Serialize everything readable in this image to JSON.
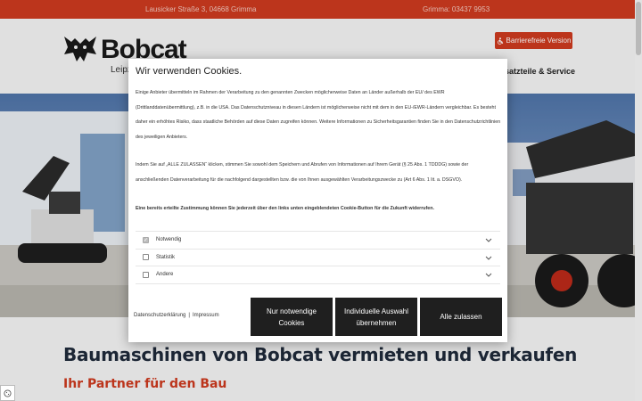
{
  "topbar": {
    "address": "Lausicker Straße 3, 04668 Grimma",
    "phone": "Grimma: 03437 9953"
  },
  "header": {
    "logo_text": "Bobcat",
    "logo_subtitle": "Leipz",
    "accessibility_button": "Barrierefreie Version",
    "nav_item": "satzteile & Service"
  },
  "content": {
    "heading": "Baumaschinen von Bobcat vermieten und verkaufen",
    "subheading": "Ihr Partner für den Bau"
  },
  "cookie_modal": {
    "title": "Wir verwenden Cookies.",
    "paragraph1": "Einige Anbieter übermitteln im Rahmen der Verarbeitung zu den genannten Zwecken möglicherweise Daten an Länder außerhalb der EU/ des EWR (Drittlanddatenübermittlung), z.B. in die USA. Das Datenschutzniveau in diesen Ländern ist möglicherweise nicht mit dem in den EU-/EWR-Ländern vergleichbar. Es besteht daher ein erhöhtes Risiko, dass staatliche Behörden auf diese Daten zugreifen können. Weitere Informationen zu Sicherheitsgarantien finden Sie in den Datenschutzrichtlinien des jeweiligen Anbieters.",
    "paragraph2": "Indem Sie auf „ALLE ZULASSEN“ klicken, stimmen Sie sowohl dem Speichern und Abrufen von Informationen auf Ihrem Gerät (§ 25 Abs. 1 TDDDG) sowie der anschließenden Datenverarbeitung für die nachfolgend dargestellten bzw. die von Ihnen ausgewählten Verarbeitungszwecke zu (Art 6 Abs. 1 lit. a. DSGVO).",
    "paragraph3": "Eine bereits erteilte Zustimmung können Sie jederzeit über den links unten eingeblendeten Cookie-Button für die Zukunft widerrufen.",
    "categories": [
      {
        "label": "Notwendig",
        "checked": true
      },
      {
        "label": "Statistik",
        "checked": false
      },
      {
        "label": "Andere",
        "checked": false
      }
    ],
    "link_privacy": "Datenschutzerklärung",
    "link_separator": "|",
    "link_imprint": "Impressum",
    "btn_necessary_line1": "Nur notwendige",
    "btn_necessary_line2": "Cookies",
    "btn_individual_line1": "Individuelle Auswahl",
    "btn_individual_line2": "übernehmen",
    "btn_allow_all": "Alle zulassen"
  },
  "colors": {
    "brand_red": "#cc3a1f",
    "button_dark": "#1f1f1f"
  },
  "icons": {
    "accessibility": "wheelchair-icon",
    "chevron": "chevron-down-icon",
    "cookie": "cookie-icon"
  }
}
